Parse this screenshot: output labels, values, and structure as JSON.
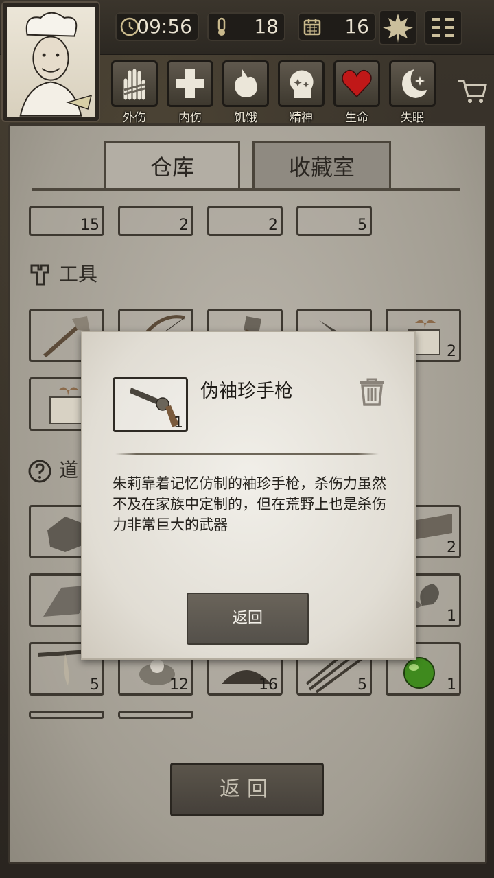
{
  "status_bar": {
    "time": "09:56",
    "temperature": "18",
    "day": "16"
  },
  "status_icons": [
    {
      "name": "external-injury",
      "label": "外伤"
    },
    {
      "name": "internal-injury",
      "label": "内伤"
    },
    {
      "name": "hunger",
      "label": "饥饿"
    },
    {
      "name": "spirit",
      "label": "精神"
    },
    {
      "name": "life",
      "label": "生命"
    },
    {
      "name": "insomnia",
      "label": "失眠"
    }
  ],
  "tabs": {
    "warehouse": "仓库",
    "collection": "收藏室"
  },
  "sections": {
    "tools": "工具",
    "props": "道"
  },
  "top_row_counts": [
    "15",
    "2",
    "2",
    "5"
  ],
  "tool_counts": [
    "",
    "",
    "",
    "",
    "2"
  ],
  "props_row1_counts": [
    "",
    "2"
  ],
  "props_row2_counts": [
    "",
    "1"
  ],
  "props_row3_counts": [
    "5",
    "12",
    "16",
    "5",
    "1"
  ],
  "modal": {
    "item_count": "1",
    "title": "伪袖珍手枪",
    "description": "朱莉靠着记忆仿制的袖珍手枪，杀伤力虽然不及在家族中定制的，但在荒野上也是杀伤力非常巨大的武器",
    "back_label": "返回"
  },
  "back_button": "返回",
  "colors": {
    "parchment": "#b9b4aa",
    "dark_frame": "#2b2620",
    "life_red": "#c01818"
  }
}
